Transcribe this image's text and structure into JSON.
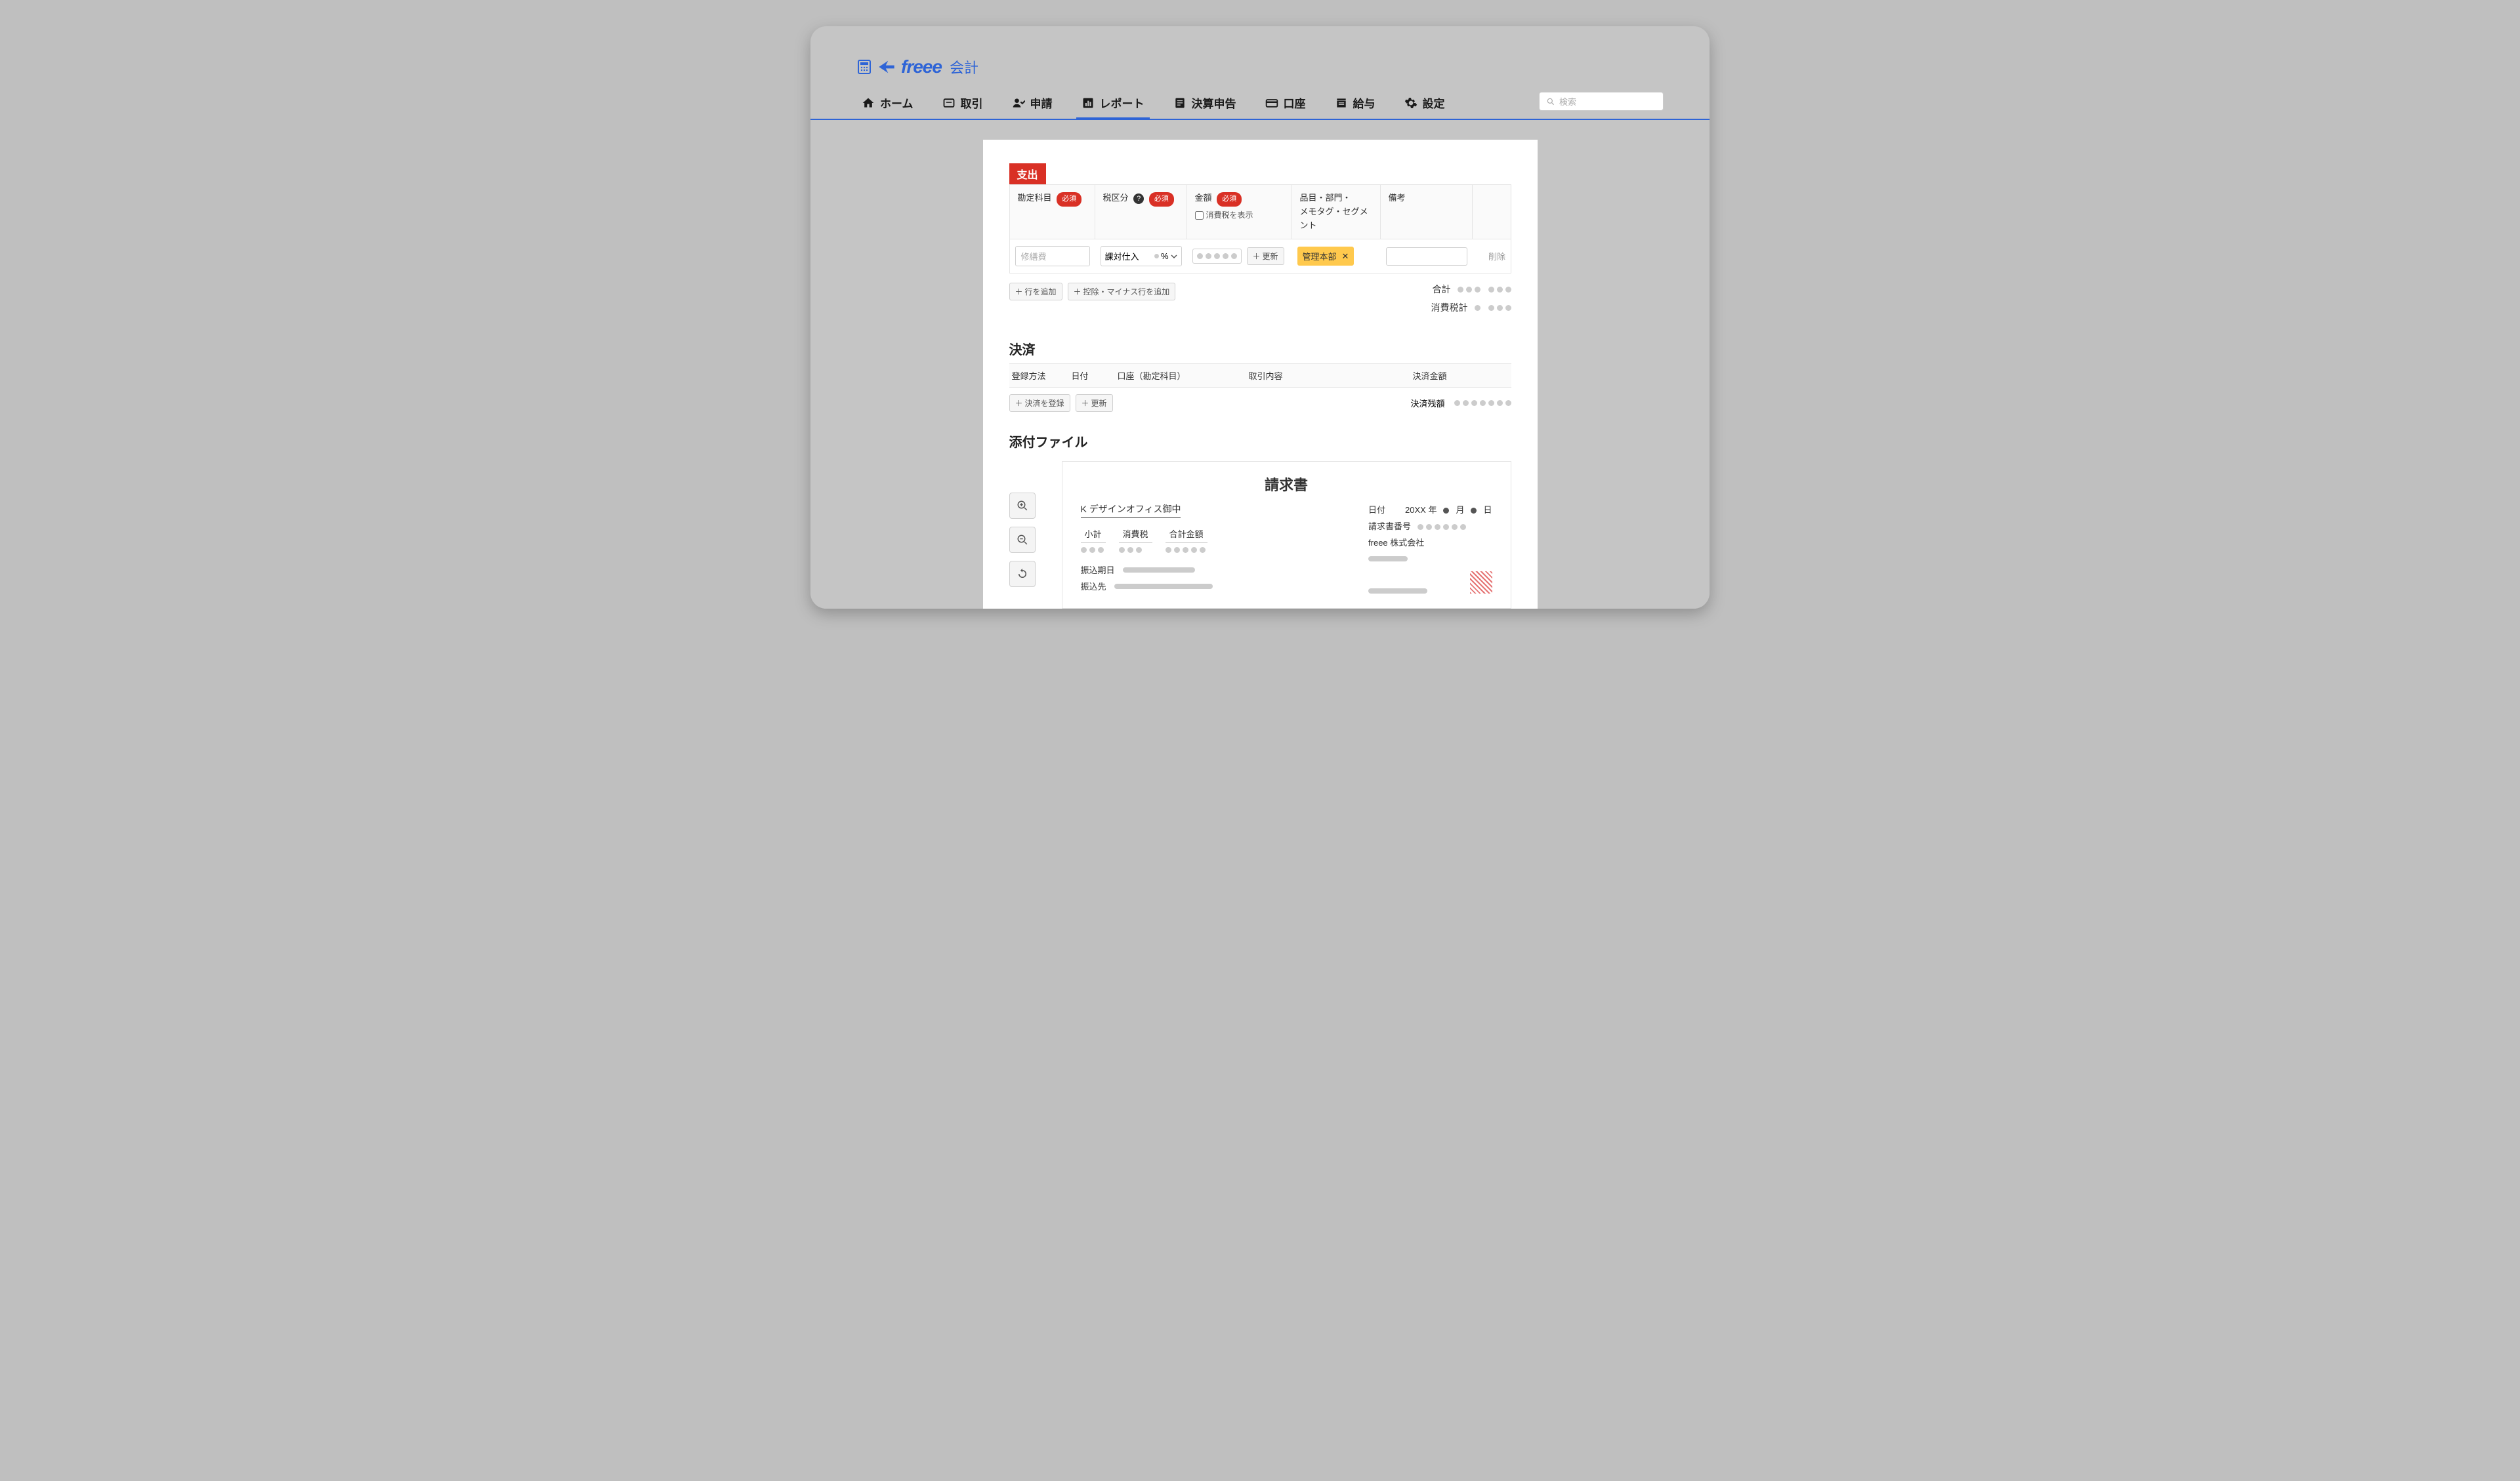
{
  "brand": {
    "name": "freee",
    "product": "会計"
  },
  "nav": {
    "home": "ホーム",
    "transactions": "取引",
    "requests": "申請",
    "reports": "レポート",
    "closing": "決算申告",
    "accounts": "口座",
    "payroll": "給与",
    "settings": "設定"
  },
  "search": {
    "placeholder": "検索"
  },
  "expense": {
    "badge": "支出",
    "head": {
      "account_item": "勘定科目",
      "tax_class": "税区分",
      "amount": "金額",
      "show_tax": "消費税を表示",
      "tags": "品目・部門・\nメモタグ・セグメント",
      "remarks": "備考"
    },
    "required": "必須",
    "row": {
      "account_placeholder": "修繕費",
      "tax_value": "課対仕入",
      "tax_pct_unit": "%",
      "update_btn": "更新",
      "tag_value": "管理本部",
      "delete": "削除"
    },
    "add_row": "行を追加",
    "add_deduction": "控除・マイナス行を追加",
    "total_label": "合計",
    "tax_total_label": "消費税計"
  },
  "payment": {
    "title": "決済",
    "head": {
      "method": "登録方法",
      "date": "日付",
      "account": "口座（勘定科目）",
      "desc": "取引内容",
      "amount": "決済金額"
    },
    "register_btn": "決済を登録",
    "update_btn": "更新",
    "balance_label": "決済残額"
  },
  "attachment": {
    "title": "添付ファイル"
  },
  "invoice": {
    "title": "請求書",
    "recipient": "K デザインオフィス御中",
    "subtotal": "小計",
    "tax": "消費税",
    "grand": "合計金額",
    "date_label": "日付",
    "date_year": "20XX 年",
    "date_month": "月",
    "date_day": "日",
    "number_label": "請求書番号",
    "issuer": "freee 株式会社",
    "due_label": "振込期日",
    "dest_label": "振込先"
  }
}
